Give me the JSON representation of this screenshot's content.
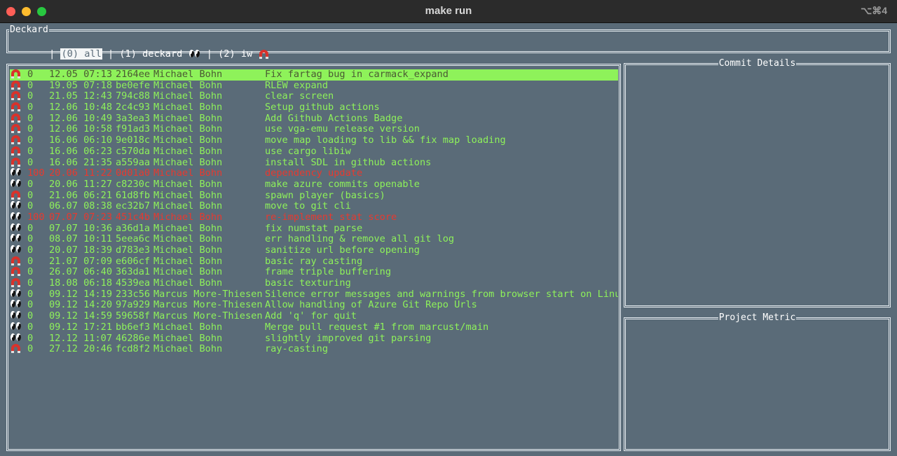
{
  "window": {
    "title": "make run",
    "shortcut": "⌥⌘4"
  },
  "app": {
    "name": "Deckard"
  },
  "tabs": {
    "prefix": "| ",
    "items": [
      {
        "label": "(0) all",
        "active": true
      },
      {
        "label": " | (1) deckard ",
        "icon": "eyes-icon"
      },
      {
        "label": " | (2) iw ",
        "icon": "magnet-icon"
      }
    ]
  },
  "panels": {
    "commit_details": "Commit Details",
    "project_metric": "Project Metric"
  },
  "commits": [
    {
      "icon": "magnet-icon",
      "num": "0",
      "date": "12.05 07:13",
      "hash": "2164ee",
      "author": "Michael Bohn",
      "msg": "Fix fartag bug in carmack_expand",
      "state": "selected"
    },
    {
      "icon": "magnet-icon",
      "num": "0",
      "date": "19.05 07:18",
      "hash": "be0efe",
      "author": "Michael Bohn",
      "msg": "RLEW expand",
      "state": "normal"
    },
    {
      "icon": "magnet-icon",
      "num": "0",
      "date": "21.05 12:43",
      "hash": "794c88",
      "author": "Michael Bohn",
      "msg": "clear screen",
      "state": "normal"
    },
    {
      "icon": "magnet-icon",
      "num": "0",
      "date": "12.06 10:48",
      "hash": "2c4c93",
      "author": "Michael Bohn",
      "msg": "Setup github actions",
      "state": "normal"
    },
    {
      "icon": "magnet-icon",
      "num": "0",
      "date": "12.06 10:49",
      "hash": "3a3ea3",
      "author": "Michael Bohn",
      "msg": "Add Github Actions Badge",
      "state": "normal"
    },
    {
      "icon": "magnet-icon",
      "num": "0",
      "date": "12.06 10:58",
      "hash": "f91ad3",
      "author": "Michael Bohn",
      "msg": "use vga-emu release version",
      "state": "normal"
    },
    {
      "icon": "magnet-icon",
      "num": "0",
      "date": "16.06 06:10",
      "hash": "9e018c",
      "author": "Michael Bohn",
      "msg": "move map loading to lib && fix map loading",
      "state": "normal"
    },
    {
      "icon": "magnet-icon",
      "num": "0",
      "date": "16.06 06:23",
      "hash": "c570da",
      "author": "Michael Bohn",
      "msg": "use cargo libiw",
      "state": "normal"
    },
    {
      "icon": "magnet-icon",
      "num": "0",
      "date": "16.06 21:35",
      "hash": "a559aa",
      "author": "Michael Bohn",
      "msg": "install SDL in github actions",
      "state": "normal"
    },
    {
      "icon": "eyes-icon",
      "num": "100",
      "date": "20.06 11:22",
      "hash": "0d01a0",
      "author": "Michael Bohn",
      "msg": "dependency update",
      "state": "alert"
    },
    {
      "icon": "eyes-icon",
      "num": "0",
      "date": "20.06 11:27",
      "hash": "c8230c",
      "author": "Michael Bohn",
      "msg": "make azure commits openable",
      "state": "normal"
    },
    {
      "icon": "magnet-icon",
      "num": "0",
      "date": "21.06 06:21",
      "hash": "61d8fb",
      "author": "Michael Bohn",
      "msg": "spawn player (basics)",
      "state": "normal"
    },
    {
      "icon": "eyes-icon",
      "num": "0",
      "date": "06.07 08:38",
      "hash": "ec32b7",
      "author": "Michael Bohn",
      "msg": "move to git cli",
      "state": "normal"
    },
    {
      "icon": "eyes-icon",
      "num": "100",
      "date": "07.07 07:23",
      "hash": "451c4b",
      "author": "Michael Bohn",
      "msg": "re-implement stat score",
      "state": "alert"
    },
    {
      "icon": "eyes-icon",
      "num": "0",
      "date": "07.07 10:36",
      "hash": "a36d1a",
      "author": "Michael Bohn",
      "msg": "fix numstat parse",
      "state": "normal"
    },
    {
      "icon": "eyes-icon",
      "num": "0",
      "date": "08.07 10:11",
      "hash": "5eea6c",
      "author": "Michael Bohn",
      "msg": "err handling & remove all git log",
      "state": "normal"
    },
    {
      "icon": "eyes-icon",
      "num": "0",
      "date": "20.07 18:39",
      "hash": "d783e3",
      "author": "Michael Bohn",
      "msg": "sanitize url before opening",
      "state": "normal"
    },
    {
      "icon": "magnet-icon",
      "num": "0",
      "date": "21.07 07:09",
      "hash": "e606cf",
      "author": "Michael Bohn",
      "msg": "basic ray casting",
      "state": "normal"
    },
    {
      "icon": "magnet-icon",
      "num": "0",
      "date": "26.07 06:40",
      "hash": "363da1",
      "author": "Michael Bohn",
      "msg": "frame triple buffering",
      "state": "normal"
    },
    {
      "icon": "magnet-icon",
      "num": "0",
      "date": "18.08 06:18",
      "hash": "4539ea",
      "author": "Michael Bohn",
      "msg": "basic texturing",
      "state": "normal"
    },
    {
      "icon": "eyes-icon",
      "num": "0",
      "date": "09.12 14:19",
      "hash": "233c56",
      "author": "Marcus More-Thiesen",
      "msg": "Silence error messages and warnings from browser start on Linux",
      "state": "normal"
    },
    {
      "icon": "eyes-icon",
      "num": "0",
      "date": "09.12 14:20",
      "hash": "97a929",
      "author": "Marcus More-Thiesen",
      "msg": "Allow handling of Azure Git Repo Urls",
      "state": "normal"
    },
    {
      "icon": "eyes-icon",
      "num": "0",
      "date": "09.12 14:59",
      "hash": "59658f",
      "author": "Marcus More-Thiesen",
      "msg": "Add 'q' for quit",
      "state": "normal"
    },
    {
      "icon": "eyes-icon",
      "num": "0",
      "date": "09.12 17:21",
      "hash": "bb6ef3",
      "author": "Michael Bohn",
      "msg": "Merge pull request #1 from marcust/main",
      "state": "normal"
    },
    {
      "icon": "eyes-icon",
      "num": "0",
      "date": "12.12 11:07",
      "hash": "46286e",
      "author": "Michael Bohn",
      "msg": "slightly improved git parsing",
      "state": "normal"
    },
    {
      "icon": "magnet-icon",
      "num": "0",
      "date": "27.12 20:46",
      "hash": "fcd8f2",
      "author": "Michael Bohn",
      "msg": "ray-casting",
      "state": "normal"
    }
  ],
  "colors": {
    "background": "#5a6b78",
    "commit_text": "#8ef25a",
    "alert_text": "#e8392f",
    "border": "#e8eef2"
  }
}
